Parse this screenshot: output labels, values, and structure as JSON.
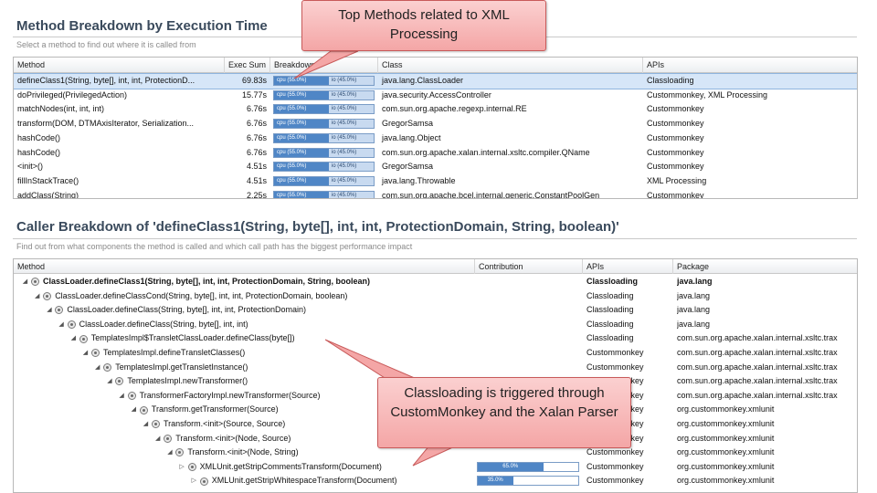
{
  "section1": {
    "title": "Method Breakdown by Execution Time",
    "subtitle": "Select a method to find out where it is called from",
    "columns": [
      "Method",
      "Exec Sum",
      "Breakdown",
      "Class",
      "APIs"
    ],
    "rows": [
      {
        "method": "defineClass1(String, byte[], int, int, ProtectionD...",
        "exec": "69.83s",
        "cpu": "cpu (55.0%)",
        "io": "io (45.0%)",
        "cls": "java.lang.ClassLoader",
        "apis": "Classloading",
        "selected": true
      },
      {
        "method": "doPrivileged(PrivilegedAction)",
        "exec": "15.77s",
        "cpu": "cpu (55.0%)",
        "io": "io (45.0%)",
        "cls": "java.security.AccessController",
        "apis": "Custommonkey, XML Processing"
      },
      {
        "method": "matchNodes(int, int, int)",
        "exec": "6.76s",
        "cpu": "cpu (55.0%)",
        "io": "io (45.0%)",
        "cls": "com.sun.org.apache.regexp.internal.RE",
        "apis": "Custommonkey"
      },
      {
        "method": "transform(DOM, DTMAxisIterator, Serialization...",
        "exec": "6.76s",
        "cpu": "cpu (55.0%)",
        "io": "io (45.0%)",
        "cls": "GregorSamsa",
        "apis": "Custommonkey"
      },
      {
        "method": "hashCode()",
        "exec": "6.76s",
        "cpu": "cpu (55.0%)",
        "io": "io (45.0%)",
        "cls": "java.lang.Object",
        "apis": "Custommonkey"
      },
      {
        "method": "hashCode()",
        "exec": "6.76s",
        "cpu": "cpu (55.0%)",
        "io": "io (45.0%)",
        "cls": "com.sun.org.apache.xalan.internal.xsltc.compiler.QName",
        "apis": "Custommonkey"
      },
      {
        "method": "<init>()",
        "exec": "4.51s",
        "cpu": "cpu (55.0%)",
        "io": "io (45.0%)",
        "cls": "GregorSamsa",
        "apis": "Custommonkey"
      },
      {
        "method": "fillInStackTrace()",
        "exec": "4.51s",
        "cpu": "cpu (55.0%)",
        "io": "io (45.0%)",
        "cls": "java.lang.Throwable",
        "apis": "XML Processing"
      },
      {
        "method": "addClass(String)",
        "exec": "2.25s",
        "cpu": "cpu (55.0%)",
        "io": "io (45.0%)",
        "cls": "com.sun.org.apache.bcel.internal.generic.ConstantPoolGen",
        "apis": "Custommonkey"
      }
    ]
  },
  "section2": {
    "title": "Caller Breakdown of 'defineClass1(String, byte[], int, int, ProtectionDomain, String, boolean)'",
    "subtitle": "Find out from what components the method is called and which call path has the biggest performance impact",
    "columns": [
      "Method",
      "Contribution",
      "APIs",
      "Package"
    ],
    "rows": [
      {
        "method": "ClassLoader.defineClass1(String, byte[], int, int, ProtectionDomain, String, boolean)",
        "apis": "Classloading",
        "pkg": "java.lang",
        "bold": true,
        "expand": "open"
      },
      {
        "method": "ClassLoader.defineClassCond(String, byte[], int, int, ProtectionDomain, boolean)",
        "apis": "Classloading",
        "pkg": "java.lang",
        "expand": "open"
      },
      {
        "method": "ClassLoader.defineClass(String, byte[], int, int, ProtectionDomain)",
        "apis": "Classloading",
        "pkg": "java.lang",
        "expand": "open"
      },
      {
        "method": "ClassLoader.defineClass(String, byte[], int, int)",
        "apis": "Classloading",
        "pkg": "java.lang",
        "expand": "open"
      },
      {
        "method": "TemplatesImpl$TransletClassLoader.defineClass(byte[])",
        "apis": "Classloading",
        "pkg": "com.sun.org.apache.xalan.internal.xsltc.trax",
        "expand": "open"
      },
      {
        "method": "TemplatesImpl.defineTransletClasses()",
        "apis": "Custommonkey",
        "pkg": "com.sun.org.apache.xalan.internal.xsltc.trax",
        "expand": "open"
      },
      {
        "method": "TemplatesImpl.getTransletInstance()",
        "apis": "Custommonkey",
        "pkg": "com.sun.org.apache.xalan.internal.xsltc.trax",
        "expand": "open"
      },
      {
        "method": "TemplatesImpl.newTransformer()",
        "apis": "Custommonkey",
        "pkg": "com.sun.org.apache.xalan.internal.xsltc.trax",
        "expand": "open"
      },
      {
        "method": "TransformerFactoryImpl.newTransformer(Source)",
        "apis": "Custommonkey",
        "pkg": "com.sun.org.apache.xalan.internal.xsltc.trax",
        "expand": "open"
      },
      {
        "method": "Transform.getTransformer(Source)",
        "apis": "Custommonkey",
        "pkg": "org.custommonkey.xmlunit",
        "expand": "open"
      },
      {
        "method": "Transform.<init>(Source, Source)",
        "apis": "Custommonkey",
        "pkg": "org.custommonkey.xmlunit",
        "expand": "open"
      },
      {
        "method": "Transform.<init>(Node, Source)",
        "apis": "Custommonkey",
        "pkg": "org.custommonkey.xmlunit",
        "expand": "open"
      },
      {
        "method": "Transform.<init>(Node, String)",
        "apis": "Custommonkey",
        "pkg": "org.custommonkey.xmlunit",
        "expand": "open"
      },
      {
        "method": "XMLUnit.getStripCommentsTransform(Document)",
        "apis": "Custommonkey",
        "pkg": "org.custommonkey.xmlunit",
        "expand": "closed",
        "contrib": 0.65,
        "contrib_label": "65.0%"
      },
      {
        "method": "XMLUnit.getStripWhitespaceTransform(Document)",
        "apis": "Custommonkey",
        "pkg": "org.custommonkey.xmlunit",
        "expand": "closed",
        "contrib": 0.35,
        "contrib_label": "35.0%"
      }
    ]
  },
  "callouts": {
    "top": "Top Methods related to XML Processing",
    "bottom": "Classloading is triggered through CustomMonkey and the Xalan Parser"
  },
  "colors": {
    "title": "#3a4a5c",
    "bar_cpu": "#4f86c6",
    "bar_io": "#c8daf0",
    "selection": "#d6e6f8",
    "callout_fill": "#f4a6a6",
    "callout_border": "#c85a5a"
  },
  "icons": {
    "expanded": "triangle-down-icon",
    "collapsed": "triangle-right-icon",
    "method": "method-icon"
  }
}
